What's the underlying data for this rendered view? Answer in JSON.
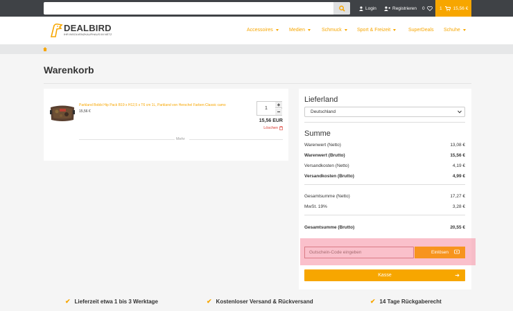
{
  "search": {
    "placeholder": ""
  },
  "topnav": {
    "login_label": "Login",
    "register_label": "Registrieren",
    "wishlist_count": "0",
    "cart_count": "1",
    "cart_total": "15,56 €"
  },
  "logo": {
    "name": "DEALBIRD",
    "tagline": "IHR INSOLVENZKAUFHAUS IM NETZ"
  },
  "nav": {
    "items": [
      {
        "label": "Accessoires",
        "has_dropdown": true
      },
      {
        "label": "Medien",
        "has_dropdown": true
      },
      {
        "label": "Schmuck",
        "has_dropdown": true
      },
      {
        "label": "Sport & Freizeit",
        "has_dropdown": true
      },
      {
        "label": "SuperDeals",
        "has_dropdown": false
      },
      {
        "label": "Schuhe",
        "has_dropdown": true
      }
    ]
  },
  "page": {
    "title": "Warenkorb"
  },
  "cart_item": {
    "name": "Parkland Bobbi Hip Pack B19 x H12,5 x T6 cm 1L, Parkland von Herschel Farben:Classic camo",
    "unit_price": "15,56 €",
    "quantity": "1",
    "line_total": "15,56 EUR",
    "delete_label": "Löschen",
    "more_label": "Mehr"
  },
  "summary": {
    "delivery_heading": "Lieferland",
    "country": "Deutschland",
    "sum_heading": "Summe",
    "rows": [
      {
        "label": "Warenwert (Netto)",
        "value": "13,08 €"
      },
      {
        "label": "Warenwert (Brutto)",
        "value": "15,56 €"
      },
      {
        "label": "Versandkosten (Netto)",
        "value": "4,19 €"
      },
      {
        "label": "Versandkosten (Brutto)",
        "value": "4,99 €"
      },
      {
        "label": "Gesamtsumme (Netto)",
        "value": "17,27 €"
      },
      {
        "label": "MwSt. 19%",
        "value": "3,28 €"
      },
      {
        "label": "Gesamtsumme (Brutto)",
        "value": "20,55 €"
      }
    ],
    "coupon_placeholder": "Gutschein-Code eingeben",
    "coupon_button": "Einlösen",
    "checkout_button": "Kasse"
  },
  "usps": [
    "Lieferzeit etwa 1 bis 3 Werktage",
    "Kostenloser Versand & Rückversand",
    "14 Tage Rückgaberecht"
  ],
  "colors": {
    "accent": "#f7a600",
    "topbar": "#3f4246",
    "danger": "#d9342b",
    "highlight": "#f58ca0"
  }
}
